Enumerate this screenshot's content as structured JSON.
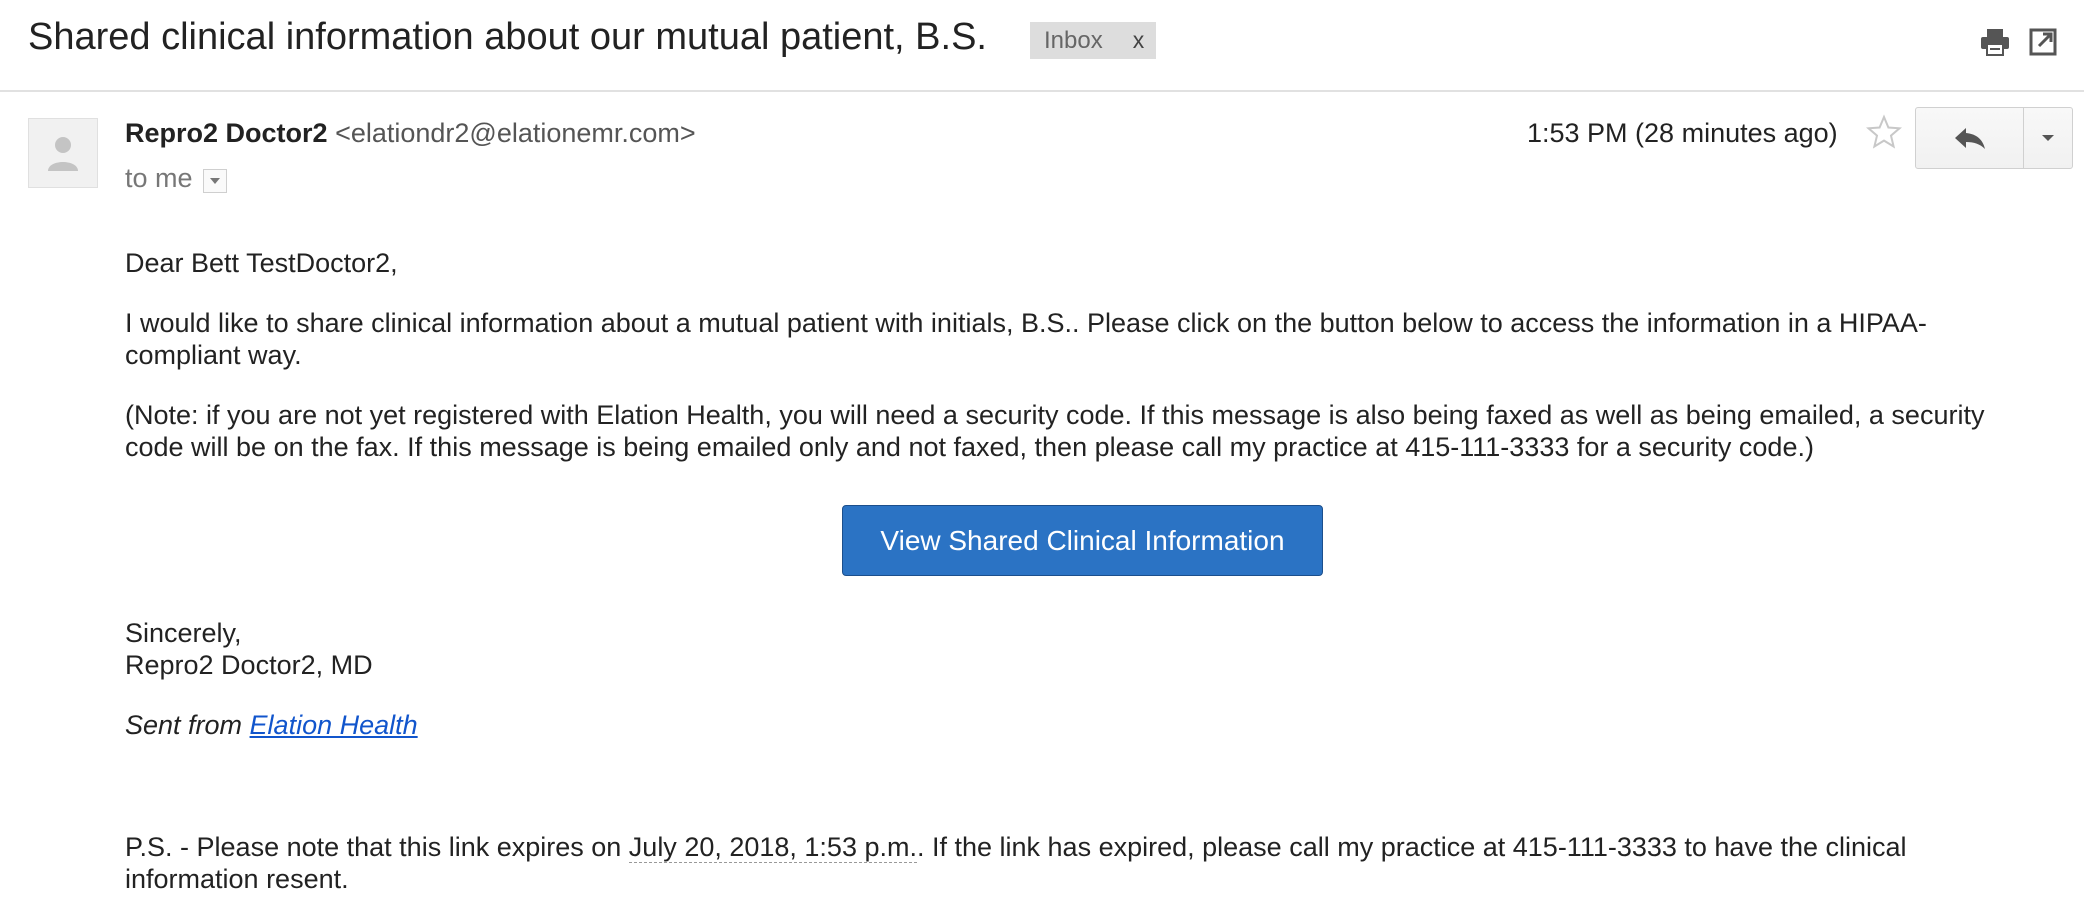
{
  "email": {
    "subject": "Shared clinical information about our mutual patient, B.S.",
    "label": "Inbox",
    "label_remove": "x",
    "sender_name": "Repro2 Doctor2",
    "sender_email": "<elationdr2@elationemr.com>",
    "to": "to me",
    "timestamp": "1:53 PM (28 minutes ago)"
  },
  "icons": {
    "print": "printer-icon",
    "new_window": "new-window-icon",
    "avatar": "person-icon",
    "star": "star-icon",
    "reply": "reply-icon",
    "more": "chevron-down-icon"
  },
  "body": {
    "greeting": "Dear Bett TestDoctor2,",
    "paragraph1": "I would like to share clinical information about a mutual patient with initials, B.S.. Please click on the button below to access the information in a HIPAA-compliant way.",
    "paragraph2": "(Note: if you are not yet registered with Elation Health, you will need a security code. If this message is also being faxed as well as being emailed, a security code will be on the fax. If this message is being emailed only and not faxed, then please call my practice at 415-111-3333 for a security code.)",
    "button_label": "View Shared Clinical Information",
    "closing": "Sincerely,",
    "signature": "Repro2 Doctor2, MD",
    "sent_from_prefix": "Sent from ",
    "sent_from_link": "Elation Health",
    "ps_prefix": "P.S. - Please note that this link expires on ",
    "ps_date": "July 20, 2018, 1:53 p.m.",
    "ps_suffix": ". If the link has expired, please call my practice at 415-111-3333 to have the clinical information resent."
  },
  "colors": {
    "button": "#2b73c4",
    "link": "#1155cc",
    "label_bg": "#dddddd"
  }
}
